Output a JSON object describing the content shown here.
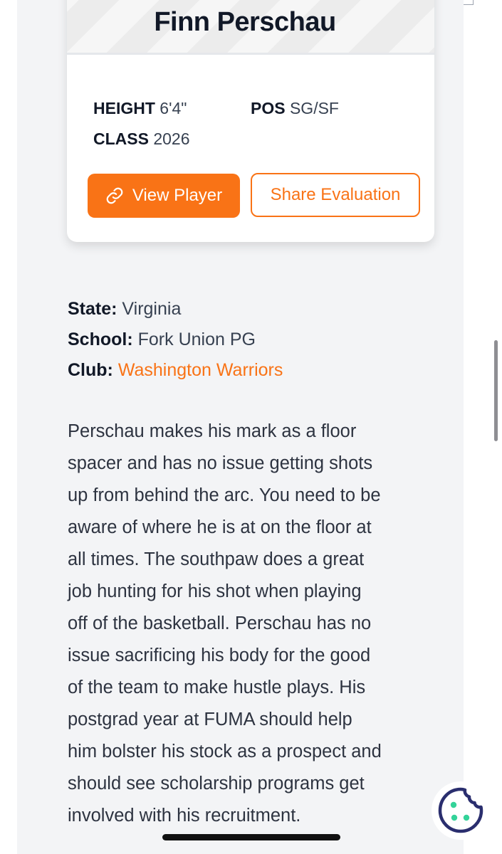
{
  "player": {
    "name": "Finn Perschau",
    "height_label": "HEIGHT",
    "height_value": "6'4\"",
    "pos_label": "POS",
    "pos_value": "SG/SF",
    "class_label": "CLASS",
    "class_value": "2026"
  },
  "actions": {
    "view_player": "View Player",
    "share_evaluation": "Share Evaluation"
  },
  "details": {
    "state_label": "State:",
    "state_value": "Virginia",
    "school_label": "School:",
    "school_value": "Fork Union PG",
    "club_label": "Club:",
    "club_value": "Washington Warriors"
  },
  "evaluation": {
    "lines": [
      "Perschau makes his mark as a floor",
      "spacer and has no issue getting shots",
      "up from behind the arc. You need to be",
      "aware of where he is at on the floor at",
      "all times. The southpaw does a great",
      "job hunting for his shot when playing",
      "off of the basketball. Perschau has no",
      "issue sacrificing his body for the good",
      "of the team to make hustle plays. His",
      "postgrad year at FUMA should help",
      "him bolster his stock as a prospect and",
      "should see scholarship programs get",
      "involved with his recruitment."
    ]
  },
  "icons": {
    "link": "link-icon",
    "cookie": "cookie-icon"
  },
  "colors": {
    "accent": "#f97316",
    "cookie_icon": "#2a2e6e",
    "cookie_dots": "#34d399"
  }
}
